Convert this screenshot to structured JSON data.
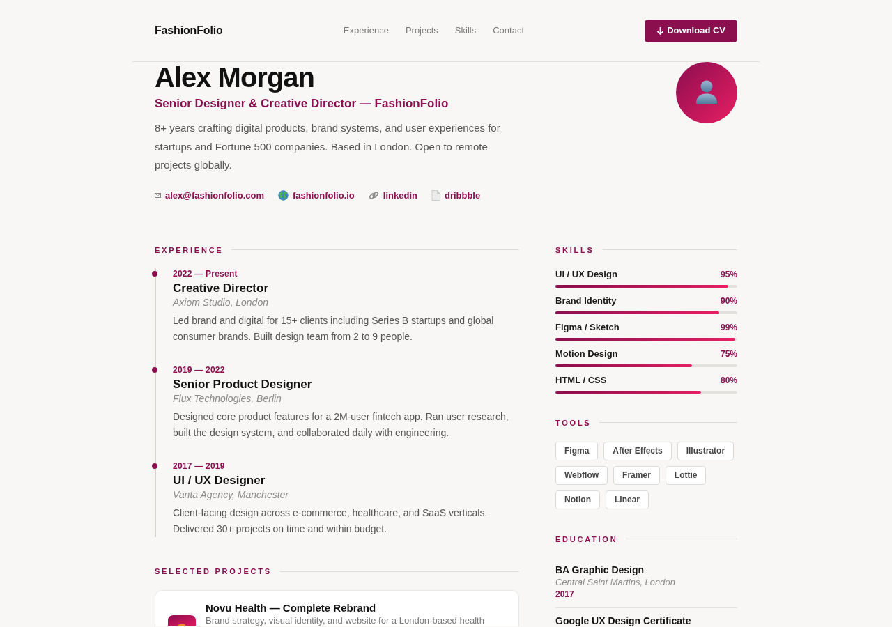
{
  "header": {
    "logo": "FashionFolio",
    "nav": [
      {
        "label": "Experience"
      },
      {
        "label": "Projects"
      },
      {
        "label": "Skills"
      },
      {
        "label": "Contact"
      }
    ],
    "download_button": "Download CV"
  },
  "profile": {
    "name": "Alex Morgan",
    "headline": "Senior Designer & Creative Director — FashionFolio",
    "bio": "8+ years crafting digital products, brand systems, and user experiences for startups and Fortune 500 companies. Based in London. Open to remote projects globally.",
    "links": [
      {
        "kind": "email",
        "label": "alex@fashionfolio.com"
      },
      {
        "kind": "website",
        "label": "fashionfolio.io"
      },
      {
        "kind": "linkedin",
        "label": "linkedin"
      },
      {
        "kind": "dribbble",
        "label": "dribbble"
      }
    ]
  },
  "experience": {
    "heading": "EXPERIENCE",
    "items": [
      {
        "dates": "2022 — Present",
        "title": "Creative Director",
        "company": "Axiom Studio, London",
        "description": "Led brand and digital for 15+ clients including Series B startups and global consumer brands. Built design team from 2 to 9 people."
      },
      {
        "dates": "2019 — 2022",
        "title": "Senior Product Designer",
        "company": "Flux Technologies, Berlin",
        "description": "Designed core product features for a 2M-user fintech app. Ran user research, built the design system, and collaborated daily with engineering."
      },
      {
        "dates": "2017 — 2019",
        "title": "UI / UX Designer",
        "company": "Vanta Agency, Manchester",
        "description": "Client-facing design across e-commerce, healthcare, and SaaS verticals. Delivered 30+ projects on time and within budget."
      }
    ]
  },
  "projects": {
    "heading": "SELECTED PROJECTS",
    "items": [
      {
        "title": "Novu Health — Complete Rebrand",
        "description": "Brand strategy, visual identity, and website for a London-based health"
      }
    ]
  },
  "skills": {
    "heading": "SKILLS",
    "items": [
      {
        "name": "UI / UX Design",
        "reading": "95%",
        "level": 0.95
      },
      {
        "name": "Brand Identity",
        "reading": "90%",
        "level": 0.9
      },
      {
        "name": "Figma / Sketch",
        "reading": "99%",
        "level": 0.99
      },
      {
        "name": "Motion Design",
        "reading": "75%",
        "level": 0.75
      },
      {
        "name": "HTML / CSS",
        "reading": "80%",
        "level": 0.8
      }
    ]
  },
  "tools": {
    "heading": "TOOLS",
    "items": [
      "Figma",
      "After Effects",
      "Illustrator",
      "Webflow",
      "Framer",
      "Lottie",
      "Notion",
      "Linear"
    ]
  },
  "education": {
    "heading": "EDUCATION",
    "items": [
      {
        "title": "BA Graphic Design",
        "institution": "Central Saint Martins, London",
        "year": "2017"
      },
      {
        "title": "Google UX Design Certificate"
      }
    ]
  }
}
